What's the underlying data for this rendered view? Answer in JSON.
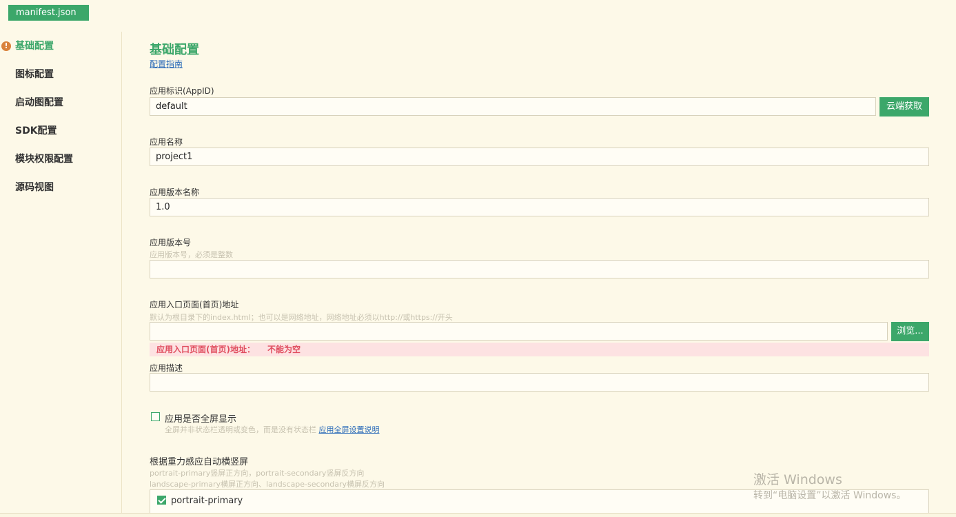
{
  "file_tab": {
    "label": "manifest.json"
  },
  "sidebar": {
    "items": [
      {
        "label": "基础配置"
      },
      {
        "label": "图标配置"
      },
      {
        "label": "启动图配置"
      },
      {
        "label": "SDK配置"
      },
      {
        "label": "模块权限配置"
      },
      {
        "label": "源码视图"
      }
    ]
  },
  "main": {
    "title": "基础配置",
    "guide_link": "配置指南",
    "appid": {
      "label": "应用标识(AppID)",
      "value": "default",
      "button": "云端获取"
    },
    "name": {
      "label": "应用名称",
      "value": "project1"
    },
    "version_name": {
      "label": "应用版本名称",
      "value": "1.0"
    },
    "version_code": {
      "label": "应用版本号",
      "hint": "应用版本号，必须是整数",
      "value": ""
    },
    "entry": {
      "label": "应用入口页面(首页)地址",
      "hint": "默认为根目录下的index.html；也可以是网络地址，网络地址必须以http://或https://开头",
      "value": "",
      "button": "浏览...",
      "error_label": "应用入口页面(首页)地址：",
      "error_msg": "不能为空"
    },
    "description": {
      "label": "应用描述",
      "value": ""
    },
    "fullscreen": {
      "label": "应用是否全屏显示",
      "checked": false,
      "hint": "全屏并非状态栏透明或变色，而是没有状态栏",
      "link": "应用全屏设置说明"
    },
    "orientation": {
      "label": "根据重力感应自动横竖屏",
      "hint1": "portrait-primary竖屏正方向，portrait-secondary竖屏反方向",
      "hint2": "landscape-primary横屏正方向、landscape-secondary横屏反方向",
      "options": [
        {
          "label": "portrait-primary",
          "checked": true
        }
      ]
    }
  },
  "watermark": {
    "line1": "激活 Windows",
    "line2": "转到“电脑设置”以激活 Windows。"
  },
  "colors": {
    "accent": "#3ca76a",
    "background": "#fdf9e8",
    "error_bg": "#fde2e2",
    "error_text": "#e04e5f",
    "link": "#2a6ab8"
  }
}
